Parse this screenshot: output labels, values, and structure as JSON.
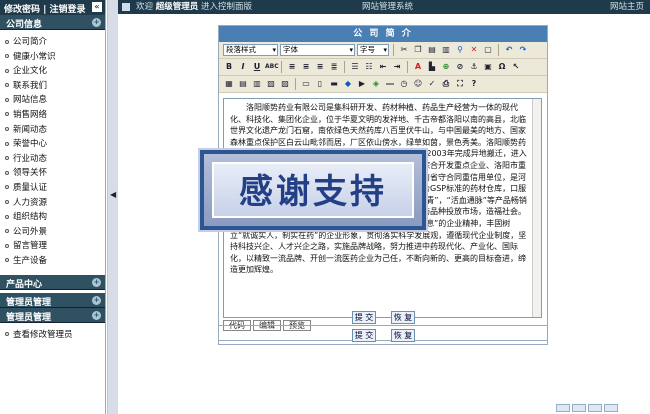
{
  "sidebar": {
    "top_links": "修改密码 | 注销登录",
    "sections": [
      {
        "title": "公司信息",
        "items": [
          "公司简介",
          "健康小常识",
          "企业文化",
          "联系我们",
          "网站信息",
          "销售网络",
          "新闻动态",
          "荣誉中心",
          "行业动态",
          "领导关怀",
          "质量认证",
          "人力资源",
          "组织结构",
          "公司外景",
          "留言管理",
          "生产设备"
        ]
      },
      {
        "title": "产品中心",
        "items": []
      },
      {
        "title": "管理员管理",
        "items": []
      },
      {
        "title": "管理员管理",
        "items": [
          "查看修改管理员"
        ]
      }
    ]
  },
  "topbar": {
    "welcome": "欢迎",
    "user": "超级管理员",
    "enter": "进入控制面版",
    "system": "网站管理系统",
    "site_home": "网站主页"
  },
  "panel": {
    "title": "公 司 简 介",
    "toolbar": {
      "format": "段落样式",
      "font": "字体",
      "size": "字号"
    },
    "content": "洛阳顺势药业有限公司是集科研开发、药材种植、药品生产经营为一体的现代化、科技化、集团化企业，位于华夏文明的发祥地、千古帝都洛阳以南的高县，北临世界文化遗产龙门石窟，南依绿色天然药库八百里伏牛山，与中国最美的地方、国家森林重点保护区白云山毗邻而居，厂区依山傍水，绿草如茵，景色秀美。洛阳顺势药业有限公司的前身为洛阳市中药三厂，始建于1969年，2003年完成异地搬迁，进入洛阳市高新技术产业开发区。公司先后被列为国家农业综合开发重点企业、洛阳市重点工程建设项目、河南省农业产业化重点龙头企业、河南省守合同重信用单位，是河南省中医药现代化科技产业基地骨干企业。公司拥有符合GSP标准的药材仓库，口服液、胶囊剂、颗粒剂等现代化生产线，“金品”，“番秦秀青”，“活血通脉”等产品畅销全国各地，公司与科研院所密切协作，不断研制开发新药品种投放市场，造福社会。顺势人将秉承“源善奋斗、励精图治、知难而进、自强不息”的企业精神，丰固树立“就诚实人，制实在药”的企业形象，贯彻落实科学发展观，遵循现代企业制度，坚持科技兴企、人才兴企之路，实施品牌战略，努力推进中药现代化、产业化、国际化，以精致一流品牌、开创一流医药企业为己任，不断向新的、更高的目标奋进，缔造更加辉煌。",
    "modes": [
      "代码",
      "编辑",
      "预览"
    ],
    "submit": "提 交",
    "reset": "恢 复"
  },
  "overlay": {
    "text": "感谢支持"
  }
}
